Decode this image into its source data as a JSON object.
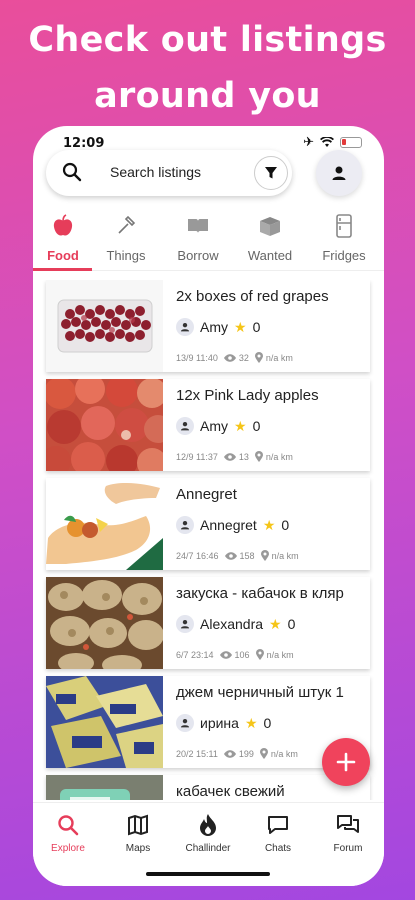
{
  "promo": {
    "line1": "Check out listings",
    "line2": "around you"
  },
  "status_bar": {
    "time": "12:09"
  },
  "search": {
    "placeholder": "Search listings"
  },
  "tabs": [
    {
      "label": "Food",
      "icon": "apple-icon",
      "active": true
    },
    {
      "label": "Things",
      "icon": "hammer-icon"
    },
    {
      "label": "Borrow",
      "icon": "book-icon"
    },
    {
      "label": "Wanted",
      "icon": "box-icon"
    },
    {
      "label": "Fridges",
      "icon": "fridge-icon"
    }
  ],
  "listings": [
    {
      "title": "2x boxes of red grapes",
      "user": "Amy",
      "rating": "0",
      "date": "13/9 11:40",
      "views": "32",
      "distance": "n/a km",
      "image": "grapes"
    },
    {
      "title": "12x Pink Lady apples",
      "user": "Amy",
      "rating": "0",
      "date": "12/9 11:37",
      "views": "13",
      "distance": "n/a km",
      "image": "apples"
    },
    {
      "title": "Annegret",
      "user": "Annegret",
      "rating": "0",
      "date": "24/7 16:46",
      "views": "158",
      "distance": "n/a km",
      "image": "illustration"
    },
    {
      "title": "закуска - кабачок в кляр",
      "user": "Alexandra",
      "rating": "0",
      "date": "6/7 23:14",
      "views": "106",
      "distance": "n/a km",
      "image": "snack"
    },
    {
      "title": "джем черничный  штук 1",
      "user": "ирина",
      "rating": "0",
      "date": "20/2 15:11",
      "views": "199",
      "distance": "n/a km",
      "image": "jam"
    },
    {
      "title": "кабачек свежий",
      "user": "",
      "rating": "",
      "date": "",
      "views": "",
      "distance": "",
      "image": "zucchini"
    }
  ],
  "bottom_nav": [
    {
      "label": "Explore",
      "icon": "search-icon",
      "active": true
    },
    {
      "label": "Maps",
      "icon": "map-icon"
    },
    {
      "label": "Challinder",
      "icon": "flame-icon"
    },
    {
      "label": "Chats",
      "icon": "chat-icon"
    },
    {
      "label": "Forum",
      "icon": "forum-icon"
    }
  ],
  "colors": {
    "accent": "#e63d5a",
    "fab": "#f0435c",
    "star": "#f5c518"
  }
}
